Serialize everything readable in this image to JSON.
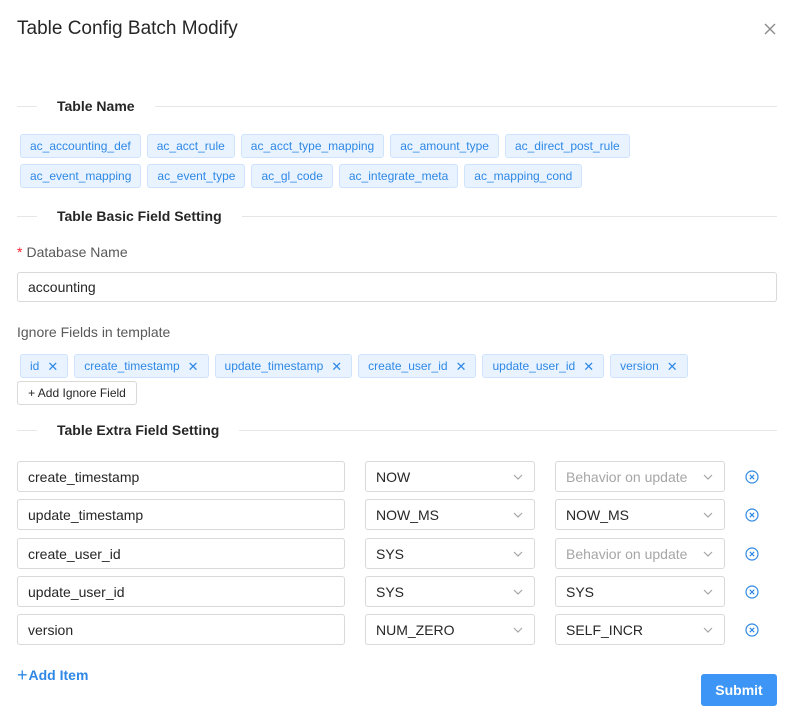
{
  "modal": {
    "title": "Table Config Batch Modify"
  },
  "sections": {
    "table_name": "Table Name",
    "basic": "Table Basic Field Setting",
    "extra": "Table Extra Field Setting"
  },
  "table_names": {
    "row1": [
      "ac_accounting_def",
      "ac_acct_rule",
      "ac_acct_type_mapping",
      "ac_amount_type",
      "ac_direct_post_rule"
    ],
    "row2": [
      "ac_event_mapping",
      "ac_event_type",
      "ac_gl_code",
      "ac_integrate_meta",
      "ac_mapping_cond"
    ]
  },
  "database": {
    "label": "Database Name",
    "value": "accounting"
  },
  "ignore": {
    "label": "Ignore Fields in template",
    "fields": [
      "id",
      "create_timestamp",
      "update_timestamp",
      "create_user_id",
      "update_user_id",
      "version"
    ],
    "add_label": "+ Add Ignore Field"
  },
  "extra_fields": [
    {
      "name": "create_timestamp",
      "insert": "NOW",
      "update": "Behavior on update",
      "update_placeholder": true
    },
    {
      "name": "update_timestamp",
      "insert": "NOW_MS",
      "update": "NOW_MS",
      "update_placeholder": false
    },
    {
      "name": "create_user_id",
      "insert": "SYS",
      "update": "Behavior on update",
      "update_placeholder": true
    },
    {
      "name": "update_user_id",
      "insert": "SYS",
      "update": "SYS",
      "update_placeholder": false
    },
    {
      "name": "version",
      "insert": "NUM_ZERO",
      "update": "SELF_INCR",
      "update_placeholder": false
    }
  ],
  "actions": {
    "add_item": "Add Item",
    "submit": "Submit"
  },
  "colors": {
    "primary": "#3d95f5",
    "tag_bg": "#e8f3ff",
    "tag_text": "#2f88e5",
    "required": "#f5222d"
  },
  "icons": {
    "close": "close-icon",
    "chevron": "chevron-down-icon",
    "remove": "remove-circle-icon",
    "tag_close": "tag-close-icon"
  }
}
